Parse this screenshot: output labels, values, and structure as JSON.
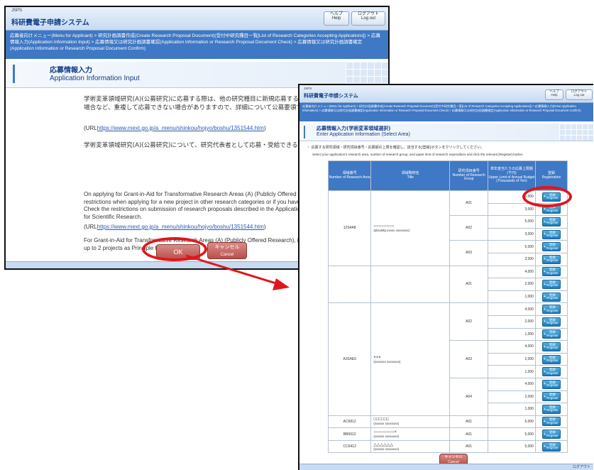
{
  "window1": {
    "brand_small": "JSPS",
    "brand": "科研費電子申請システム",
    "help": {
      "jp": "ヘルプ",
      "en": "Help"
    },
    "logout": {
      "jp": "ログアウト",
      "en": "Log out"
    },
    "breadcrumb": "応募者向けメニュー(Menu for Applicant) > 研究計画調書作成(Create Research Proposal Document)(受付中研究種目一覧[List of Research Categories Accepting Applications]) > 応募情報入力(Application Information Input) > 応募情報又は研究計画調書確認(Application Information or Research Proposal Document Check) > 応募情報又は研究計画調書確定(Application Information or Research Proposal Document Confirm)",
    "page_title_jp": "応募情報入力",
    "page_title_en": "Application Information Input",
    "para1_jp": "学術変革領域研究(A)(公募研究)に応募する際は、他の研究種目に新規応募する場合や継続研究課題を有する場合など、重複して応募できない場合がありますので、詳細について公募要領で確認してください。",
    "url_label": "(URL",
    "url": "https://www.mext.go.jp/a_menu/shinkou/hojyo/boshu/1351544.htm",
    "url_close": ")",
    "para2_jp": "学術変革領域研究(A)(公募研究)について、研究代表者として応募・受給できるのは、2件までです。",
    "para3_en": "On applying for Grant-in-Aid for Transformative Research Areas (A) (Publicly Offered Research) there may be some restrictions when applying for a new project in other research categories or if you have a continued research project. Check the restrictions on submission of research proposals described in the Application Procedures for Grants-in-Aid for Scientific Research.",
    "para4_en": "For Grant-in-Aid for Transformative Research Areas (A) (Publicly Offered Research), it is possible to receive grants for up to 2 projects as Principle Investigator.",
    "ok": "OK",
    "cancel": {
      "jp": "キャンセル",
      "en": "Cancel"
    }
  },
  "window2": {
    "brand_small": "JSPS",
    "brand": "科研費電子申請システム",
    "help": {
      "jp": "ヘルプ",
      "en": "Help"
    },
    "logout": {
      "jp": "ログアウト",
      "en": "Log out"
    },
    "breadcrumb": "応募者向けメニュー(Menu for Applicant) > 研究計画調書作成(Create Research Proposal Document)(受付中研究種目一覧[List of Research Categories Accepting Applications]) > 応募情報入力(Enter Application Information) > 応募情報又は研究計画調書確認(Application Information or Research Proposal Document Check) > 応募情報又は研究計画調書確定(Application Information or Research Proposal Document Confirm)",
    "page_title_jp": "応募情報入力(学術変革領域選択)",
    "page_title_en": "Enter Application Information (Select Area)",
    "instr_jp": "応募する研究領域・研究項目番号・応募額の上限を確認し、該当する[登録]ボタンをクリックしてください。",
    "instr_en": "Select your application's research area, number of research group, and upper limit of research expenditure and click the relevant [Register] button.",
    "headers": {
      "area": "領域番号\nNumber of Research Area",
      "title": "領域略称名\nTitle",
      "group": "研究項目番号\nNumber of Research Group",
      "limit": "単年度当たりの応募上限額(千円)\nUpper Limit of Annual Budget (Thousands of Yen)",
      "reg": "登録\nRegistration"
    },
    "register": {
      "jp": "登録",
      "en": "Register"
    },
    "areas": [
      {
        "num": "12S4A8",
        "title": "○○○○○○○○",
        "title_en": "(abcdefg xxxxx xxxxxxxx)",
        "groups": [
          {
            "g": "A01",
            "limits": [
              "5,000",
              "3,000"
            ]
          },
          {
            "g": "A02",
            "limits": [
              "5,000",
              "3,000"
            ]
          },
          {
            "g": "A03",
            "limits": [
              "5,000",
              "3,000"
            ]
          }
        ]
      },
      {
        "num": "",
        "title": "",
        "title_en": "",
        "groups": [
          {
            "g": "A01",
            "limits": [
              "4,000",
              "2,000",
              "1,000"
            ]
          }
        ]
      },
      {
        "num": "A3S4E6",
        "title": "×××",
        "title_en": "(xxxxxxx xxxxxxxx)",
        "groups": [
          {
            "g": "A02",
            "limits": [
              "4,000",
              "2,000",
              "1,000"
            ]
          },
          {
            "g": "A03",
            "limits": [
              "4,000",
              "2,000",
              "1,000"
            ]
          },
          {
            "g": "A04",
            "limits": [
              "4,000",
              "2,000",
              "1,000"
            ]
          }
        ]
      },
      {
        "num": "AC6812",
        "title": "□□□□□□",
        "title_en": "(xxxxxx xxxxxxxx)",
        "groups": [
          {
            "g": "A01",
            "limits": [
              "5,000"
            ]
          }
        ]
      },
      {
        "num": "BB6912",
        "title": "○○○○○○○○×",
        "title_en": "(xxxxxx xxxxxxxx)",
        "groups": [
          {
            "g": "A01",
            "limits": [
              "5,000"
            ]
          }
        ]
      },
      {
        "num": "CC6412",
        "title": "△△△△△△",
        "title_en": "(xxxxxx xxxxxxxx)",
        "groups": [
          {
            "g": "A01",
            "limits": [
              "5,000"
            ]
          }
        ]
      }
    ],
    "cancel": {
      "jp": "キャンセル",
      "en": "Cancel"
    },
    "footer_logout": "ログアウト"
  },
  "colors": {
    "highlight": "#e0161c",
    "header_blue": "#3f78c4",
    "register_blue": "#1e7cbf",
    "brand_blue": "#123d86"
  }
}
